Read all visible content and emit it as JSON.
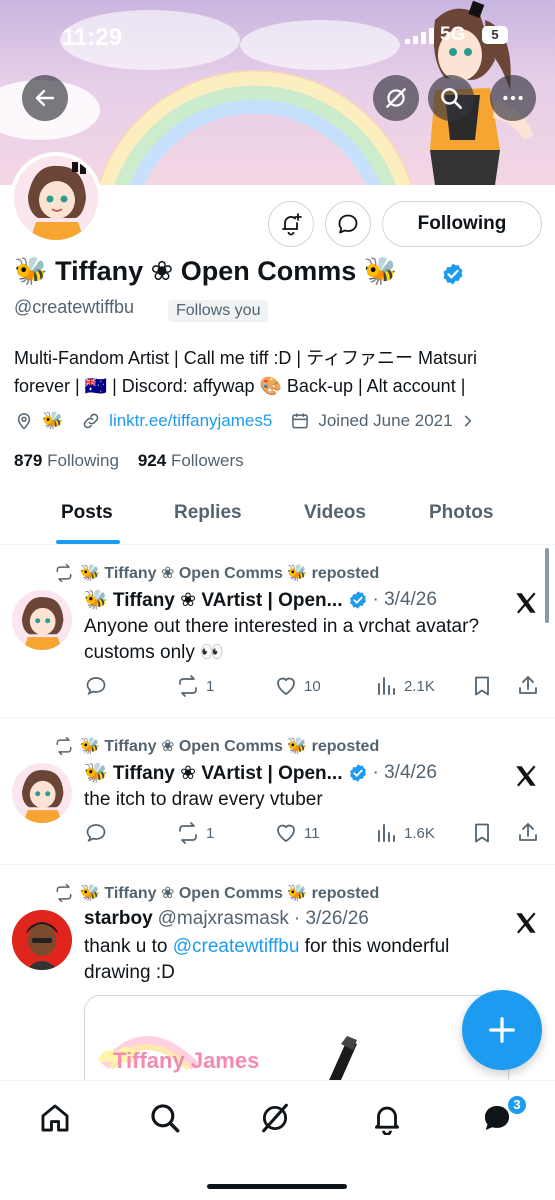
{
  "status_bar": {
    "time": "11:29",
    "network": "5G",
    "battery": "5"
  },
  "header_actions": {
    "back": "back-arrow-icon",
    "grok": "grok-icon",
    "search": "search-icon",
    "more": "more-icon"
  },
  "profile": {
    "display_name": "🐝 Tiffany ❀ Open Comms 🐝",
    "handle": "@createwtiffbu",
    "follows_you": "Follows you",
    "follow_button": "Following",
    "bio_line1": "Multi-Fandom Artist | Call me tiff :D | ティファニー Matsuri",
    "bio_line2": "forever | 🇦🇺 | Discord: affywap 🎨 Back-up | Alt account |",
    "location": "🐝",
    "link": "linktr.ee/tiffanyjames5",
    "joined": "Joined June 2021",
    "following_count": "879",
    "following_label": "Following",
    "followers_count": "924",
    "followers_label": "Followers"
  },
  "tabs": [
    "Posts",
    "Replies",
    "Videos",
    "Photos"
  ],
  "posts": [
    {
      "repost_label": "🐝 Tiffany ❀ Open Comms 🐝 reposted",
      "author": "🐝 Tiffany ❀ VArtist | Open...",
      "date": "· 3/4/26",
      "text": "Anyone out there interested in a vrchat avatar? customs only 👀",
      "replies": "",
      "reposts": "1",
      "likes": "10",
      "views": "2.1K"
    },
    {
      "repost_label": "🐝 Tiffany ❀ Open Comms 🐝 reposted",
      "author": "🐝 Tiffany ❀ VArtist | Open...",
      "date": "· 3/4/26",
      "text": "the itch to draw every vtuber",
      "replies": "",
      "reposts": "1",
      "likes": "11",
      "views": "1.6K"
    },
    {
      "repost_label": "🐝 Tiffany ❀ Open Comms 🐝 reposted",
      "author": "starboy",
      "handle": "@majxrasmask",
      "date": "· 3/26/26",
      "text_before": "thank u to ",
      "mention": "@createwtiffbu",
      "text_after": " for this wonderful drawing :D"
    }
  ],
  "embed": {
    "logo_text": "Tiffany James"
  },
  "bottom_nav": {
    "messages_badge": "3"
  },
  "colors": {
    "accent": "#1d9bf0",
    "text": "#0f1419",
    "muted": "#536471"
  }
}
